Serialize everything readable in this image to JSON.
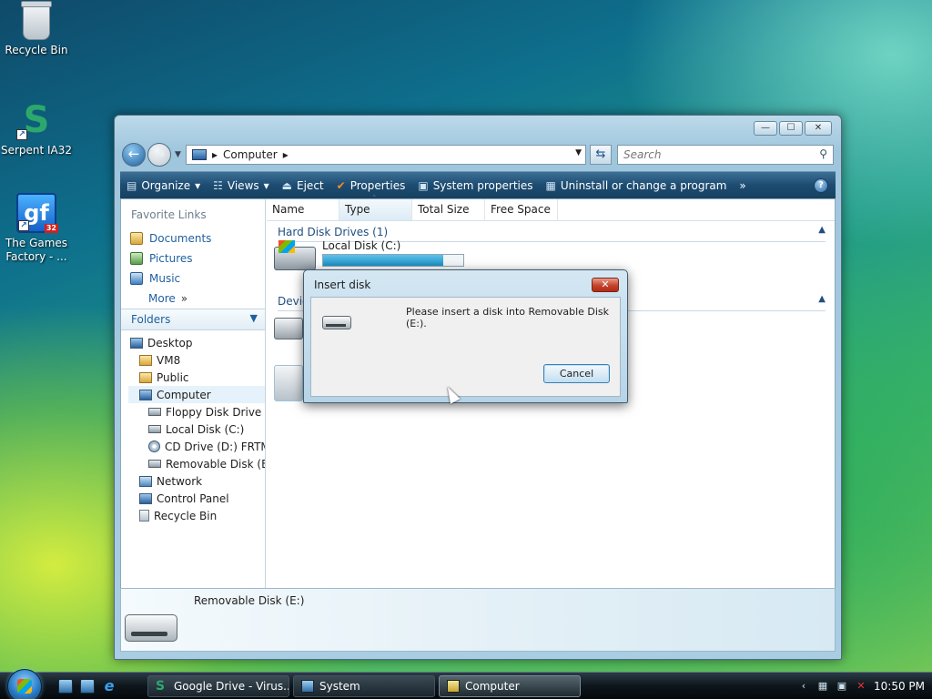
{
  "desktop": {
    "icons": [
      {
        "label": "Recycle Bin"
      },
      {
        "label": "Serpent IA32"
      },
      {
        "label": "The Games Factory - ...",
        "line1": "The Games",
        "line2": "Factory - ...",
        "logo_text": "gf",
        "badge": "32"
      }
    ]
  },
  "explorer": {
    "window_controls": {
      "minimize": "—",
      "maximize": "☐",
      "close": "✕"
    },
    "address": {
      "path_root": "▸",
      "path": "Computer",
      "sep": "▸"
    },
    "search": {
      "placeholder": "Search"
    },
    "toolbar": {
      "organize": "Organize",
      "views": "Views",
      "eject": "Eject",
      "properties": "Properties",
      "system_properties": "System properties",
      "uninstall": "Uninstall or change a program",
      "overflow": "»",
      "help": "?"
    },
    "nav": {
      "favorite_links_title": "Favorite Links",
      "favorites": [
        "Documents",
        "Pictures",
        "Music"
      ],
      "more": "More",
      "more_chevron": "»",
      "folders_title": "Folders",
      "tree": [
        {
          "label": "Desktop",
          "level": 0
        },
        {
          "label": "VM8",
          "level": 1
        },
        {
          "label": "Public",
          "level": 1
        },
        {
          "label": "Computer",
          "level": 1
        },
        {
          "label": "Floppy Disk Drive (A",
          "level": 2
        },
        {
          "label": "Local Disk (C:)",
          "level": 2
        },
        {
          "label": "CD Drive (D:) FRTMI",
          "level": 2
        },
        {
          "label": "Removable Disk (E:)",
          "level": 2
        },
        {
          "label": "Network",
          "level": 1
        },
        {
          "label": "Control Panel",
          "level": 1
        },
        {
          "label": "Recycle Bin",
          "level": 1
        }
      ]
    },
    "columns": [
      "Name",
      "Type",
      "Total Size",
      "Free Space"
    ],
    "groups": {
      "hard_disks": "Hard Disk Drives (1)",
      "devices": "Devices with Removable Storage (3)",
      "devices_visible": "Devic"
    },
    "local_disk": {
      "name": "Local Disk (C:)",
      "used_fraction": 0.86
    },
    "details": {
      "name": "Removable Disk (E:)"
    }
  },
  "dialog": {
    "title": "Insert disk",
    "close": "✕",
    "message": "Please insert a disk into Removable Disk (E:).",
    "cancel": "Cancel"
  },
  "taskbar": {
    "tasks": [
      "Google Drive - Virus...",
      "System",
      "Computer"
    ],
    "clock": "10:50 PM",
    "tray_arrow": "‹"
  }
}
